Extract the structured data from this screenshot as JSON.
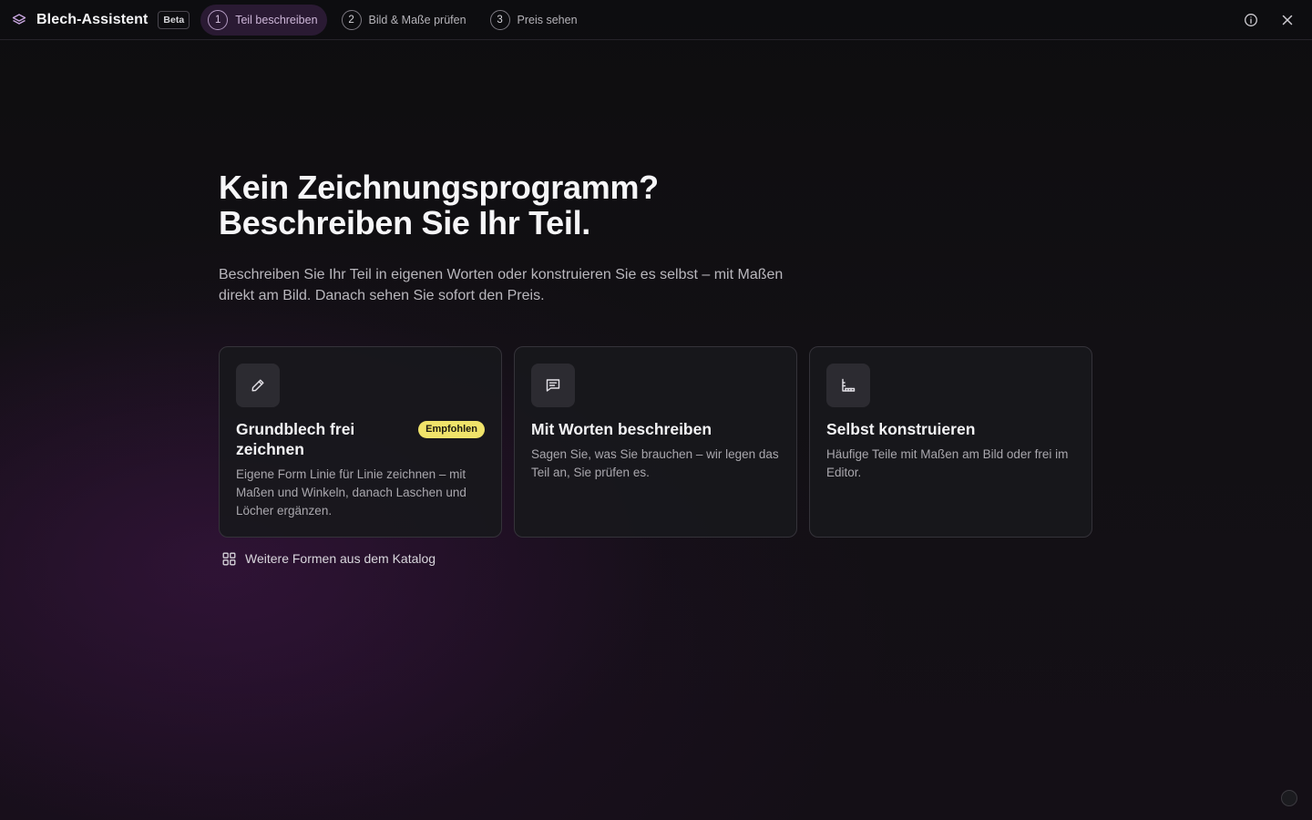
{
  "app": {
    "title": "Blech-Assistent",
    "badge": "Beta"
  },
  "steps": [
    {
      "number": "1",
      "label": "Teil beschreiben",
      "active": true
    },
    {
      "number": "2",
      "label": "Bild & Maße prüfen",
      "active": false
    },
    {
      "number": "3",
      "label": "Preis sehen",
      "active": false
    }
  ],
  "header_actions": [
    {
      "icon": "info-icon"
    },
    {
      "icon": "close-icon"
    }
  ],
  "main": {
    "headline_line1": "Kein Zeichnungsprogramm?",
    "headline_line2": "Beschreiben Sie Ihr Teil.",
    "subtitle": "Beschreiben Sie Ihr Teil in eigenen Worten oder konstruieren Sie es selbst – mit Maßen direkt am Bild. Danach sehen Sie sofort den Preis."
  },
  "cards": [
    {
      "icon": "pencil-icon",
      "title": "Grundblech frei zeichnen",
      "badge": "Empfohlen",
      "description": "Eigene Form Linie für Linie zeichnen – mit Maßen und Winkeln, danach Laschen und Löcher ergänzen."
    },
    {
      "icon": "message-icon",
      "title": "Mit Worten beschreiben",
      "description": "Sagen Sie, was Sie brauchen – wir legen das Teil an, Sie prüfen es."
    },
    {
      "icon": "ruler-corner-icon",
      "title": "Selbst konstruieren",
      "description": "Häufige Teile mit Maßen am Bild oder frei im Editor."
    }
  ],
  "catalog_link": {
    "icon": "grid-icon",
    "label": "Weitere Formen aus dem Katalog"
  },
  "colors": {
    "accent_badge": "#f0e36a",
    "active_step_bg": "#2a1a33"
  }
}
